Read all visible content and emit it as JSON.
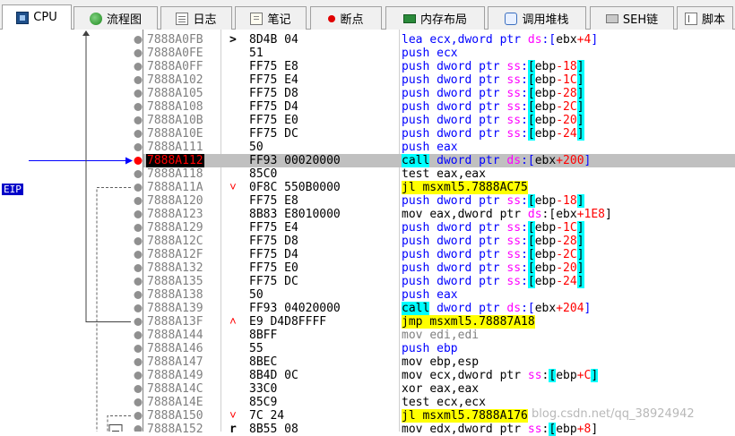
{
  "tabs": [
    {
      "id": "cpu",
      "label": "CPU",
      "icon": "cpu-icon",
      "active": true
    },
    {
      "id": "flow",
      "label": "流程图",
      "icon": "graph-icon"
    },
    {
      "id": "log",
      "label": "日志",
      "icon": "log-icon"
    },
    {
      "id": "notes",
      "label": "笔记",
      "icon": "notes-icon"
    },
    {
      "id": "breakpoints",
      "label": "断点",
      "icon": "breakpoint-dot-icon"
    },
    {
      "id": "memory",
      "label": "内存布局",
      "icon": "memory-map-icon"
    },
    {
      "id": "callstack",
      "label": "调用堆栈",
      "icon": "call-stack-icon"
    },
    {
      "id": "seh",
      "label": "SEH链",
      "icon": "seh-icon"
    },
    {
      "id": "script",
      "label": "脚本",
      "icon": "script-icon"
    }
  ],
  "eip_label": "EIP",
  "rows": [
    {
      "addr": "7888A0FB",
      "mark": ">",
      "bytes": "8D4B 04",
      "mn": "lea",
      "ops": [
        {
          "t": "ecx,dword ptr "
        },
        {
          "s": "ds"
        },
        {
          "t": ":["
        },
        {
          "r": "ebx"
        },
        {
          "o": "+4"
        },
        {
          "t": "]"
        }
      ]
    },
    {
      "addr": "7888A0FE",
      "bytes": "51",
      "mn": "push",
      "ops": [
        {
          "t": "ecx"
        }
      ]
    },
    {
      "addr": "7888A0FF",
      "bytes": "FF75 E8",
      "mn": "push",
      "ops": [
        {
          "t": "dword ptr "
        },
        {
          "s": "ss"
        },
        {
          "t": ":"
        },
        {
          "b": "["
        },
        {
          "r": "ebp"
        },
        {
          "o": "-18"
        },
        {
          "b": "]"
        }
      ]
    },
    {
      "addr": "7888A102",
      "bytes": "FF75 E4",
      "mn": "push",
      "ops": [
        {
          "t": "dword ptr "
        },
        {
          "s": "ss"
        },
        {
          "t": ":"
        },
        {
          "b": "["
        },
        {
          "r": "ebp"
        },
        {
          "o": "-1C"
        },
        {
          "b": "]"
        }
      ]
    },
    {
      "addr": "7888A105",
      "bytes": "FF75 D8",
      "mn": "push",
      "ops": [
        {
          "t": "dword ptr "
        },
        {
          "s": "ss"
        },
        {
          "t": ":"
        },
        {
          "b": "["
        },
        {
          "r": "ebp"
        },
        {
          "o": "-28"
        },
        {
          "b": "]"
        }
      ]
    },
    {
      "addr": "7888A108",
      "bytes": "FF75 D4",
      "mn": "push",
      "ops": [
        {
          "t": "dword ptr "
        },
        {
          "s": "ss"
        },
        {
          "t": ":"
        },
        {
          "b": "["
        },
        {
          "r": "ebp"
        },
        {
          "o": "-2C"
        },
        {
          "b": "]"
        }
      ]
    },
    {
      "addr": "7888A10B",
      "bytes": "FF75 E0",
      "mn": "push",
      "ops": [
        {
          "t": "dword ptr "
        },
        {
          "s": "ss"
        },
        {
          "t": ":"
        },
        {
          "b": "["
        },
        {
          "r": "ebp"
        },
        {
          "o": "-20"
        },
        {
          "b": "]"
        }
      ]
    },
    {
      "addr": "7888A10E",
      "bytes": "FF75 DC",
      "mn": "push",
      "ops": [
        {
          "t": "dword ptr "
        },
        {
          "s": "ss"
        },
        {
          "t": ":"
        },
        {
          "b": "["
        },
        {
          "r": "ebp"
        },
        {
          "o": "-24"
        },
        {
          "b": "]"
        }
      ]
    },
    {
      "addr": "7888A111",
      "bytes": "50",
      "mn": "push",
      "ops": [
        {
          "t": "eax"
        }
      ]
    },
    {
      "addr": "7888A112",
      "current": true,
      "bytes": "FF93 00020000",
      "mn": "call",
      "mnhl": "cyan",
      "ops": [
        {
          "t": "dword ptr "
        },
        {
          "s": "ds"
        },
        {
          "t": ":["
        },
        {
          "r": "ebx"
        },
        {
          "o": "+200"
        },
        {
          "t": "]"
        }
      ]
    },
    {
      "addr": "7888A118",
      "bytes": "85C0",
      "mn": "test",
      "mnk": "mov",
      "ops": [
        {
          "t": "eax,eax"
        }
      ]
    },
    {
      "addr": "7888A11A",
      "mark": "˅",
      "mark_up": true,
      "bytes": "0F8C 550B0000",
      "mn": "jl",
      "hl": "yellow",
      "ops": [
        {
          "t": "msxml5.7888AC75"
        }
      ]
    },
    {
      "addr": "7888A120",
      "bytes": "FF75 E8",
      "mn": "push",
      "ops": [
        {
          "t": "dword ptr "
        },
        {
          "s": "ss"
        },
        {
          "t": ":"
        },
        {
          "b": "["
        },
        {
          "r": "ebp"
        },
        {
          "o": "-18"
        },
        {
          "b": "]"
        }
      ]
    },
    {
      "addr": "7888A123",
      "bytes": "8B83 E8010000",
      "mn": "mov",
      "mnk": "mov",
      "ops": [
        {
          "t": "eax,dword ptr "
        },
        {
          "s": "ds"
        },
        {
          "t": ":["
        },
        {
          "r": "ebx"
        },
        {
          "o": "+1E8"
        },
        {
          "t": "]"
        }
      ]
    },
    {
      "addr": "7888A129",
      "bytes": "FF75 E4",
      "mn": "push",
      "ops": [
        {
          "t": "dword ptr "
        },
        {
          "s": "ss"
        },
        {
          "t": ":"
        },
        {
          "b": "["
        },
        {
          "r": "ebp"
        },
        {
          "o": "-1C"
        },
        {
          "b": "]"
        }
      ]
    },
    {
      "addr": "7888A12C",
      "bytes": "FF75 D8",
      "mn": "push",
      "ops": [
        {
          "t": "dword ptr "
        },
        {
          "s": "ss"
        },
        {
          "t": ":"
        },
        {
          "b": "["
        },
        {
          "r": "ebp"
        },
        {
          "o": "-28"
        },
        {
          "b": "]"
        }
      ]
    },
    {
      "addr": "7888A12F",
      "bytes": "FF75 D4",
      "mn": "push",
      "ops": [
        {
          "t": "dword ptr "
        },
        {
          "s": "ss"
        },
        {
          "t": ":"
        },
        {
          "b": "["
        },
        {
          "r": "ebp"
        },
        {
          "o": "-2C"
        },
        {
          "b": "]"
        }
      ]
    },
    {
      "addr": "7888A132",
      "bytes": "FF75 E0",
      "mn": "push",
      "ops": [
        {
          "t": "dword ptr "
        },
        {
          "s": "ss"
        },
        {
          "t": ":"
        },
        {
          "b": "["
        },
        {
          "r": "ebp"
        },
        {
          "o": "-20"
        },
        {
          "b": "]"
        }
      ]
    },
    {
      "addr": "7888A135",
      "bytes": "FF75 DC",
      "mn": "push",
      "ops": [
        {
          "t": "dword ptr "
        },
        {
          "s": "ss"
        },
        {
          "t": ":"
        },
        {
          "b": "["
        },
        {
          "r": "ebp"
        },
        {
          "o": "-24"
        },
        {
          "b": "]"
        }
      ]
    },
    {
      "addr": "7888A138",
      "bytes": "50",
      "mn": "push",
      "ops": [
        {
          "t": "eax"
        }
      ]
    },
    {
      "addr": "7888A139",
      "bytes": "FF93 04020000",
      "mn": "call",
      "mnhl": "cyan",
      "ops": [
        {
          "t": "dword ptr "
        },
        {
          "s": "ds"
        },
        {
          "t": ":["
        },
        {
          "r": "ebx"
        },
        {
          "o": "+204"
        },
        {
          "t": "]"
        }
      ]
    },
    {
      "addr": "7888A13F",
      "mark": "˄",
      "mark_up": true,
      "bytes": "E9 D4D8FFFF",
      "mn": "jmp",
      "hl": "yellow",
      "ops": [
        {
          "t": "msxml5.78887A18"
        }
      ]
    },
    {
      "addr": "7888A144",
      "bytes": "8BFF",
      "mn": "mov",
      "mnk": "dim",
      "ops": [
        {
          "t": "edi,edi",
          "dim": true
        }
      ]
    },
    {
      "addr": "7888A146",
      "bytes": "55",
      "mn": "push",
      "ops": [
        {
          "t": "ebp"
        }
      ]
    },
    {
      "addr": "7888A147",
      "bytes": "8BEC",
      "mn": "mov",
      "mnk": "mov",
      "ops": [
        {
          "t": "ebp,esp"
        }
      ]
    },
    {
      "addr": "7888A149",
      "bytes": "8B4D 0C",
      "mn": "mov",
      "mnk": "mov",
      "ops": [
        {
          "t": "ecx,dword ptr "
        },
        {
          "s": "ss"
        },
        {
          "t": ":"
        },
        {
          "b": "["
        },
        {
          "r": "ebp"
        },
        {
          "o": "+C"
        },
        {
          "b": "]"
        }
      ]
    },
    {
      "addr": "7888A14C",
      "bytes": "33C0",
      "mn": "xor",
      "mnk": "mov",
      "ops": [
        {
          "t": "eax,eax"
        }
      ]
    },
    {
      "addr": "7888A14E",
      "bytes": "85C9",
      "mn": "test",
      "mnk": "mov",
      "ops": [
        {
          "t": "ecx,ecx"
        }
      ]
    },
    {
      "addr": "7888A150",
      "mark": "˅",
      "mark_up": true,
      "bytes": "7C 24",
      "mn": "jl",
      "hl": "yellow",
      "ops": [
        {
          "t": "msxml5.7888A176"
        }
      ]
    },
    {
      "addr": "7888A152",
      "mark": "r",
      "bytes": "8B55 08",
      "mn": "mov",
      "mnk": "mov",
      "ops": [
        {
          "t": "edx,dword ptr "
        },
        {
          "s": "ss"
        },
        {
          "t": ":"
        },
        {
          "b": "["
        },
        {
          "r": "ebp"
        },
        {
          "o": "+8"
        },
        {
          "t": "]"
        }
      ]
    }
  ],
  "watermark": "https://blog.csdn.net/qq_38924942",
  "watermark_visible": "blog.csdn.net/qq_38924942"
}
